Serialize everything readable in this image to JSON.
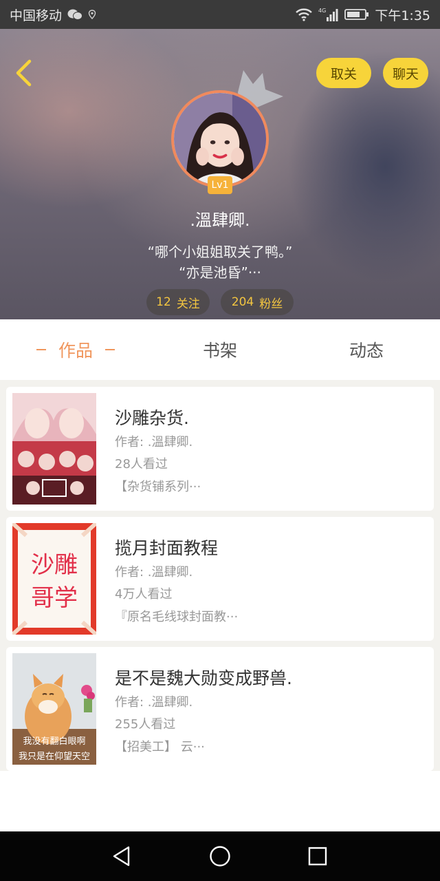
{
  "status_bar": {
    "carrier": "中国移动",
    "network": "4G",
    "time": "下午1:35"
  },
  "header": {
    "unfollow_label": "取关",
    "chat_label": "聊天",
    "level": "Lv1",
    "username": ".溫肆卿.",
    "bio_line1": "“哪个小姐姐取关了鸭。”",
    "bio_line2": "“亦是池昏”···",
    "following_count": "12",
    "following_label": "关注",
    "fans_count": "204",
    "fans_label": "粉丝"
  },
  "tabs": {
    "works": "作品",
    "shelf": "书架",
    "feed": "动态"
  },
  "books": [
    {
      "title": "沙雕杂货.",
      "author": "作者: .溫肆卿.",
      "views": "28人看过",
      "desc": "【杂货铺系列···"
    },
    {
      "title": "揽月封面教程",
      "author": "作者: .溫肆卿.",
      "views": "4万人看过",
      "desc": "『原名毛线球封面教···"
    },
    {
      "title": "是不是魏大勋变成野兽.",
      "author": "作者: .溫肆卿.",
      "views": "255人看过",
      "desc": "【招美工】 云···"
    }
  ],
  "cover_text": {
    "cover2_line1": "沙雕",
    "cover2_line2": "哥学",
    "cover3_line1": "我没有翻白眼啊",
    "cover3_line2": "我只是在仰望天空"
  },
  "colors": {
    "accent_yellow": "#f7d43a",
    "tab_active": "#f0965c",
    "stat_text": "#f4c640"
  },
  "icons": {
    "back": "back-arrow-icon",
    "crown": "crown-icon",
    "nav_back": "triangle-back-icon",
    "nav_home": "circle-home-icon",
    "nav_recent": "square-recent-icon"
  }
}
